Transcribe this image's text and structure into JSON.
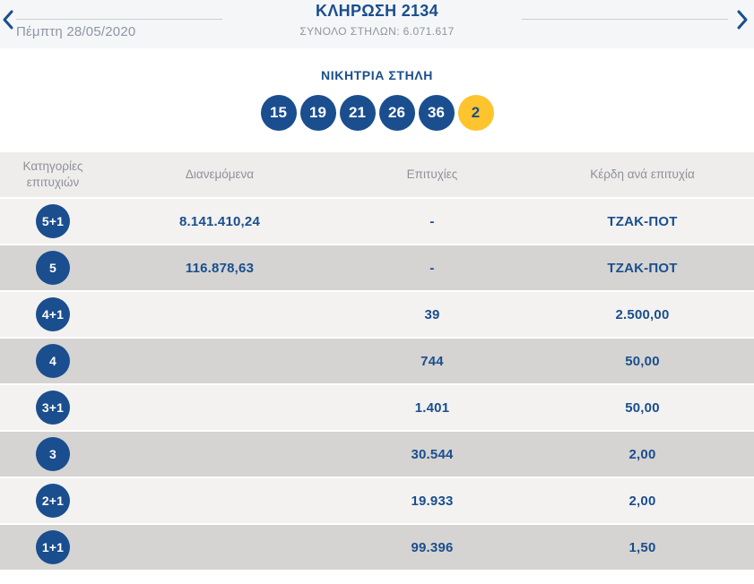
{
  "colors": {
    "accent_blue": "#1a4e8e",
    "joker_yellow": "#fdc42d",
    "grey_text": "#8d949e",
    "row_light": "#f3f2f0",
    "row_dark": "#d5d4d2"
  },
  "header": {
    "title": "ΚΛΗΡΩΣΗ 2134",
    "subtitle": "ΣΥΝΟΛΟ ΣΤΗΛΩΝ: 6.071.617",
    "prev_date": "Πέμπτη 28/05/2020",
    "prev_icon": "chevron-left",
    "next_icon": "chevron-right"
  },
  "winning": {
    "title": "ΝΙΚΗΤΡΙΑ ΣΤΗΛΗ",
    "numbers": [
      "15",
      "19",
      "21",
      "26",
      "36"
    ],
    "joker": "2"
  },
  "table": {
    "headers": {
      "category": "Κατηγορίες επιτυχιών",
      "distributed": "Διανεμόμενα",
      "successes": "Επιτυχίες",
      "winnings": "Κέρδη ανά επιτυχία"
    },
    "rows": [
      {
        "category": "5+1",
        "distributed": "8.141.410,24",
        "successes": "-",
        "winnings": "ΤΖΑΚ-ΠΟΤ"
      },
      {
        "category": "5",
        "distributed": "116.878,63",
        "successes": "-",
        "winnings": "ΤΖΑΚ-ΠΟΤ"
      },
      {
        "category": "4+1",
        "distributed": "",
        "successes": "39",
        "winnings": "2.500,00"
      },
      {
        "category": "4",
        "distributed": "",
        "successes": "744",
        "winnings": "50,00"
      },
      {
        "category": "3+1",
        "distributed": "",
        "successes": "1.401",
        "winnings": "50,00"
      },
      {
        "category": "3",
        "distributed": "",
        "successes": "30.544",
        "winnings": "2,00"
      },
      {
        "category": "2+1",
        "distributed": "",
        "successes": "19.933",
        "winnings": "2,00"
      },
      {
        "category": "1+1",
        "distributed": "",
        "successes": "99.396",
        "winnings": "1,50"
      }
    ]
  }
}
